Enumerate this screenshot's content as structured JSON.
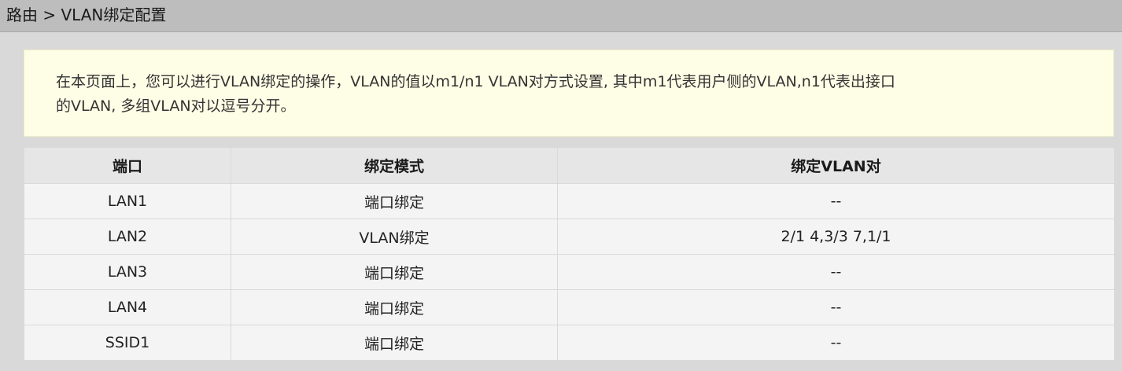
{
  "breadcrumb": "路由 > VLAN绑定配置",
  "notice": {
    "line1": "在本页面上，您可以进行VLAN绑定的操作，VLAN的值以m1/n1 VLAN对方式设置, 其中m1代表用户侧的VLAN,n1代表出接口",
    "line2": "的VLAN, 多组VLAN对以逗号分开。"
  },
  "table": {
    "headers": [
      "端口",
      "绑定模式",
      "绑定VLAN对"
    ],
    "rows": [
      {
        "port": "LAN1",
        "mode": "端口绑定",
        "vlan_pairs": "--"
      },
      {
        "port": "LAN2",
        "mode": "VLAN绑定",
        "vlan_pairs": "2/1  4,3/3  7,1/1"
      },
      {
        "port": "LAN3",
        "mode": "端口绑定",
        "vlan_pairs": "--"
      },
      {
        "port": "LAN4",
        "mode": "端口绑定",
        "vlan_pairs": "--"
      },
      {
        "port": "SSID1",
        "mode": "端口绑定",
        "vlan_pairs": "--"
      }
    ]
  },
  "colors": {
    "titlebar_bg": "#bdbdbd",
    "page_bg": "#d9d9d9",
    "notice_bg": "#fefee6",
    "header_bg": "#e6e6e6",
    "row_bg": "#f4f4f4"
  }
}
